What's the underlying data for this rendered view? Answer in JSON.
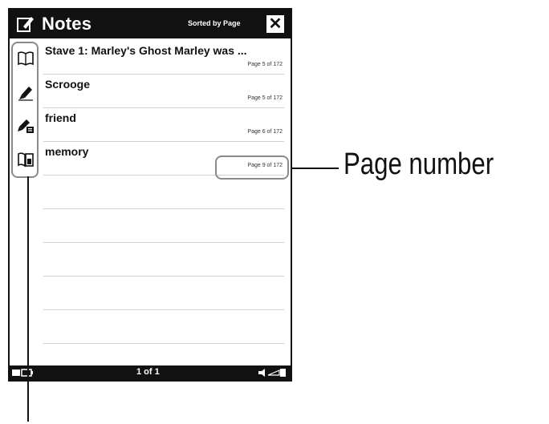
{
  "titlebar": {
    "title": "Notes",
    "sort_label": "Sorted by Page",
    "close_label": "✕",
    "icon": "notes-pencil-icon"
  },
  "notes": [
    {
      "text": "Stave 1: Marley's Ghost Marley was ...",
      "page": "Page 5 of 172"
    },
    {
      "text": "Scrooge",
      "page": "Page 5 of 172"
    },
    {
      "text": "friend",
      "page": "Page 6 of 172"
    },
    {
      "text": "memory",
      "page": "Page 9 of 172"
    }
  ],
  "icon_column": [
    "bookmark-icon",
    "highlight-icon",
    "handwriting-icon",
    "bookmark-comment-icon"
  ],
  "statusbar": {
    "page_indicator": "1 of 1",
    "left_icon": "battery-icon",
    "right_icon": "volume-icon"
  },
  "callouts": {
    "page_number_label": "Page number"
  }
}
